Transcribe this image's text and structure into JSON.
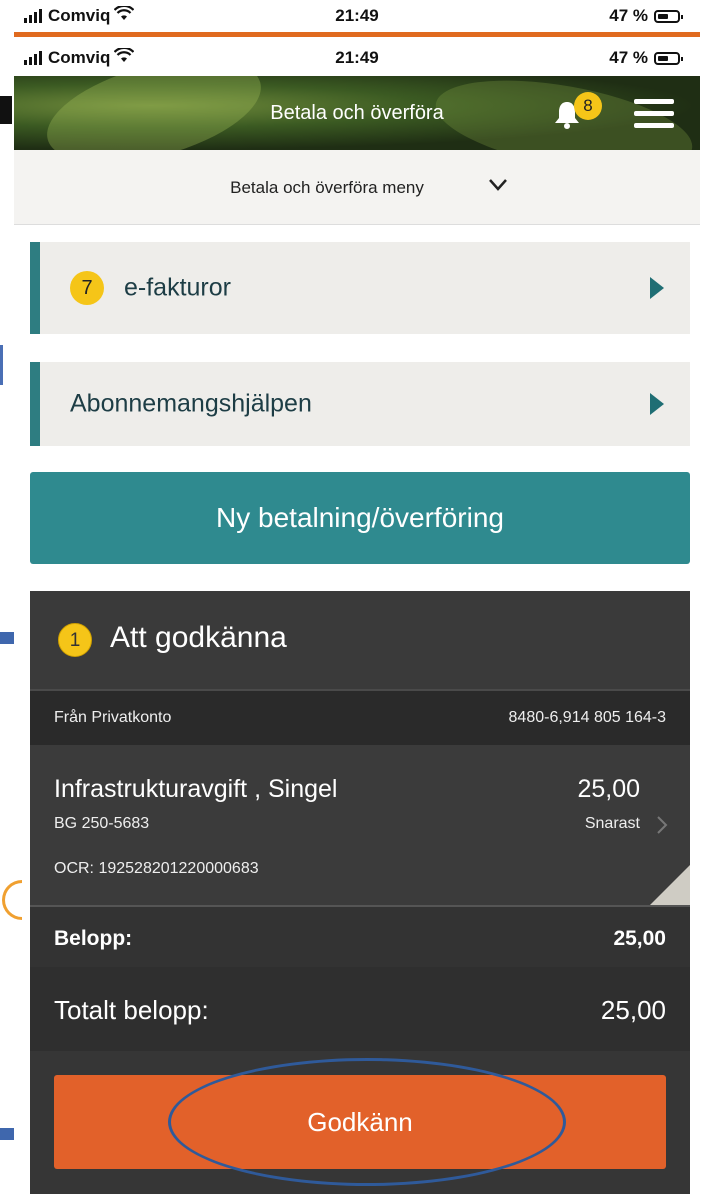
{
  "status_bar": {
    "carrier": "Comviq",
    "time": "21:49",
    "battery": "47 %"
  },
  "header": {
    "title": "Betala och överföra",
    "notification_count": "8"
  },
  "submenu": {
    "label": "Betala och överföra meny"
  },
  "list": [
    {
      "badge": "7",
      "label": "e-fakturor"
    },
    {
      "label": "Abonnemangshjälpen"
    }
  ],
  "primary_button": {
    "label": "Ny betalning/överföring"
  },
  "approval_card": {
    "badge": "1",
    "title": "Att godkänna",
    "from_label": "Från Privatkonto",
    "from_account": "8480-6,914 805 164-3",
    "payment": {
      "name": "Infrastrukturavgift , Singel",
      "bankgiro": "BG 250-5683",
      "ocr": "OCR: 192528201220000683",
      "amount": "25,00",
      "when": "Snarast"
    },
    "belopp_label": "Belopp:",
    "belopp_value": "25,00",
    "total_label": "Totalt belopp:",
    "total_value": "25,00",
    "approve_label": "Godkänn"
  },
  "colors": {
    "teal": "#2f8a8f",
    "orange": "#e2612a",
    "badge_yellow": "#f5c518",
    "card_dark": "#363636"
  }
}
